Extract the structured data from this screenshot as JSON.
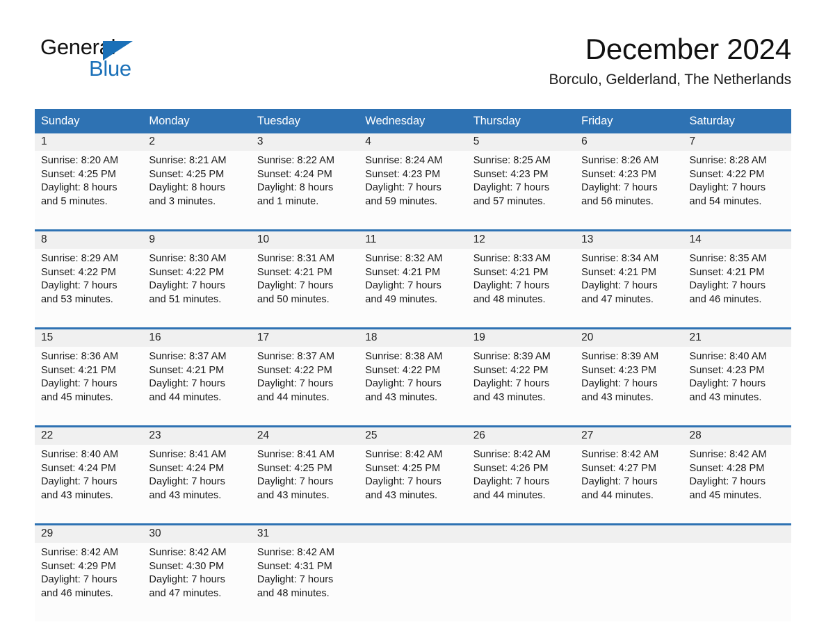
{
  "brand": {
    "line1": "General",
    "line2": "Blue",
    "triangle_color": "#1a70b8"
  },
  "header": {
    "title": "December 2024",
    "subtitle": "Borculo, Gelderland, The Netherlands"
  },
  "theme": {
    "header_blue": "#2e72b3",
    "daynum_band": "#f0f0f0",
    "cell_bg": "#fcfcfc",
    "text": "#1a1a1a"
  },
  "weekday_headers": [
    "Sunday",
    "Monday",
    "Tuesday",
    "Wednesday",
    "Thursday",
    "Friday",
    "Saturday"
  ],
  "weeks": [
    {
      "days": [
        {
          "num": "1",
          "l1": "Sunrise: 8:20 AM",
          "l2": "Sunset: 4:25 PM",
          "l3": "Daylight: 8 hours",
          "l4": "and 5 minutes."
        },
        {
          "num": "2",
          "l1": "Sunrise: 8:21 AM",
          "l2": "Sunset: 4:25 PM",
          "l3": "Daylight: 8 hours",
          "l4": "and 3 minutes."
        },
        {
          "num": "3",
          "l1": "Sunrise: 8:22 AM",
          "l2": "Sunset: 4:24 PM",
          "l3": "Daylight: 8 hours",
          "l4": "and 1 minute."
        },
        {
          "num": "4",
          "l1": "Sunrise: 8:24 AM",
          "l2": "Sunset: 4:23 PM",
          "l3": "Daylight: 7 hours",
          "l4": "and 59 minutes."
        },
        {
          "num": "5",
          "l1": "Sunrise: 8:25 AM",
          "l2": "Sunset: 4:23 PM",
          "l3": "Daylight: 7 hours",
          "l4": "and 57 minutes."
        },
        {
          "num": "6",
          "l1": "Sunrise: 8:26 AM",
          "l2": "Sunset: 4:23 PM",
          "l3": "Daylight: 7 hours",
          "l4": "and 56 minutes."
        },
        {
          "num": "7",
          "l1": "Sunrise: 8:28 AM",
          "l2": "Sunset: 4:22 PM",
          "l3": "Daylight: 7 hours",
          "l4": "and 54 minutes."
        }
      ]
    },
    {
      "days": [
        {
          "num": "8",
          "l1": "Sunrise: 8:29 AM",
          "l2": "Sunset: 4:22 PM",
          "l3": "Daylight: 7 hours",
          "l4": "and 53 minutes."
        },
        {
          "num": "9",
          "l1": "Sunrise: 8:30 AM",
          "l2": "Sunset: 4:22 PM",
          "l3": "Daylight: 7 hours",
          "l4": "and 51 minutes."
        },
        {
          "num": "10",
          "l1": "Sunrise: 8:31 AM",
          "l2": "Sunset: 4:21 PM",
          "l3": "Daylight: 7 hours",
          "l4": "and 50 minutes."
        },
        {
          "num": "11",
          "l1": "Sunrise: 8:32 AM",
          "l2": "Sunset: 4:21 PM",
          "l3": "Daylight: 7 hours",
          "l4": "and 49 minutes."
        },
        {
          "num": "12",
          "l1": "Sunrise: 8:33 AM",
          "l2": "Sunset: 4:21 PM",
          "l3": "Daylight: 7 hours",
          "l4": "and 48 minutes."
        },
        {
          "num": "13",
          "l1": "Sunrise: 8:34 AM",
          "l2": "Sunset: 4:21 PM",
          "l3": "Daylight: 7 hours",
          "l4": "and 47 minutes."
        },
        {
          "num": "14",
          "l1": "Sunrise: 8:35 AM",
          "l2": "Sunset: 4:21 PM",
          "l3": "Daylight: 7 hours",
          "l4": "and 46 minutes."
        }
      ]
    },
    {
      "days": [
        {
          "num": "15",
          "l1": "Sunrise: 8:36 AM",
          "l2": "Sunset: 4:21 PM",
          "l3": "Daylight: 7 hours",
          "l4": "and 45 minutes."
        },
        {
          "num": "16",
          "l1": "Sunrise: 8:37 AM",
          "l2": "Sunset: 4:21 PM",
          "l3": "Daylight: 7 hours",
          "l4": "and 44 minutes."
        },
        {
          "num": "17",
          "l1": "Sunrise: 8:37 AM",
          "l2": "Sunset: 4:22 PM",
          "l3": "Daylight: 7 hours",
          "l4": "and 44 minutes."
        },
        {
          "num": "18",
          "l1": "Sunrise: 8:38 AM",
          "l2": "Sunset: 4:22 PM",
          "l3": "Daylight: 7 hours",
          "l4": "and 43 minutes."
        },
        {
          "num": "19",
          "l1": "Sunrise: 8:39 AM",
          "l2": "Sunset: 4:22 PM",
          "l3": "Daylight: 7 hours",
          "l4": "and 43 minutes."
        },
        {
          "num": "20",
          "l1": "Sunrise: 8:39 AM",
          "l2": "Sunset: 4:23 PM",
          "l3": "Daylight: 7 hours",
          "l4": "and 43 minutes."
        },
        {
          "num": "21",
          "l1": "Sunrise: 8:40 AM",
          "l2": "Sunset: 4:23 PM",
          "l3": "Daylight: 7 hours",
          "l4": "and 43 minutes."
        }
      ]
    },
    {
      "days": [
        {
          "num": "22",
          "l1": "Sunrise: 8:40 AM",
          "l2": "Sunset: 4:24 PM",
          "l3": "Daylight: 7 hours",
          "l4": "and 43 minutes."
        },
        {
          "num": "23",
          "l1": "Sunrise: 8:41 AM",
          "l2": "Sunset: 4:24 PM",
          "l3": "Daylight: 7 hours",
          "l4": "and 43 minutes."
        },
        {
          "num": "24",
          "l1": "Sunrise: 8:41 AM",
          "l2": "Sunset: 4:25 PM",
          "l3": "Daylight: 7 hours",
          "l4": "and 43 minutes."
        },
        {
          "num": "25",
          "l1": "Sunrise: 8:42 AM",
          "l2": "Sunset: 4:25 PM",
          "l3": "Daylight: 7 hours",
          "l4": "and 43 minutes."
        },
        {
          "num": "26",
          "l1": "Sunrise: 8:42 AM",
          "l2": "Sunset: 4:26 PM",
          "l3": "Daylight: 7 hours",
          "l4": "and 44 minutes."
        },
        {
          "num": "27",
          "l1": "Sunrise: 8:42 AM",
          "l2": "Sunset: 4:27 PM",
          "l3": "Daylight: 7 hours",
          "l4": "and 44 minutes."
        },
        {
          "num": "28",
          "l1": "Sunrise: 8:42 AM",
          "l2": "Sunset: 4:28 PM",
          "l3": "Daylight: 7 hours",
          "l4": "and 45 minutes."
        }
      ]
    },
    {
      "days": [
        {
          "num": "29",
          "l1": "Sunrise: 8:42 AM",
          "l2": "Sunset: 4:29 PM",
          "l3": "Daylight: 7 hours",
          "l4": "and 46 minutes."
        },
        {
          "num": "30",
          "l1": "Sunrise: 8:42 AM",
          "l2": "Sunset: 4:30 PM",
          "l3": "Daylight: 7 hours",
          "l4": "and 47 minutes."
        },
        {
          "num": "31",
          "l1": "Sunrise: 8:42 AM",
          "l2": "Sunset: 4:31 PM",
          "l3": "Daylight: 7 hours",
          "l4": "and 48 minutes."
        },
        {
          "num": "",
          "l1": "",
          "l2": "",
          "l3": "",
          "l4": ""
        },
        {
          "num": "",
          "l1": "",
          "l2": "",
          "l3": "",
          "l4": ""
        },
        {
          "num": "",
          "l1": "",
          "l2": "",
          "l3": "",
          "l4": ""
        },
        {
          "num": "",
          "l1": "",
          "l2": "",
          "l3": "",
          "l4": ""
        }
      ]
    }
  ]
}
